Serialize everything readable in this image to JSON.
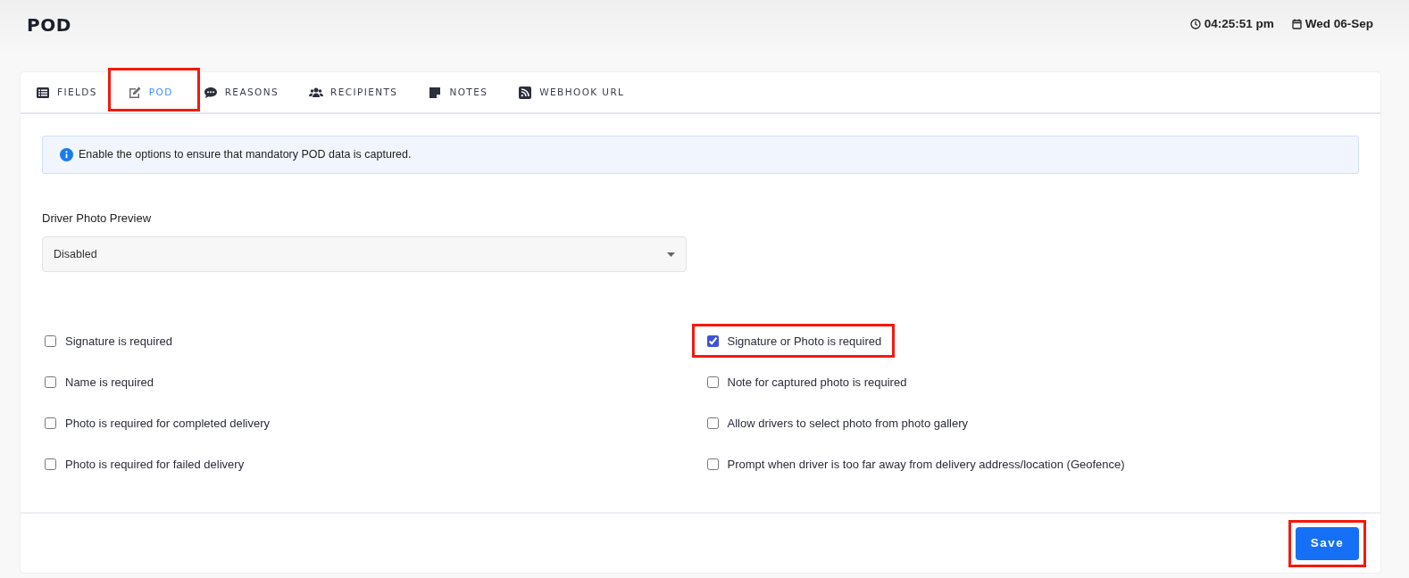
{
  "page": {
    "title": "POD",
    "time": "04:25:51 pm",
    "date": "Wed 06-Sep"
  },
  "tabs": [
    {
      "label": "FIELDS",
      "selected": false,
      "highlighted": false
    },
    {
      "label": "POD",
      "selected": true,
      "highlighted": true
    },
    {
      "label": "REASONS",
      "selected": false,
      "highlighted": false
    },
    {
      "label": "RECIPIENTS",
      "selected": false,
      "highlighted": false
    },
    {
      "label": "NOTES",
      "selected": false,
      "highlighted": false
    },
    {
      "label": "WEBHOOK URL",
      "selected": false,
      "highlighted": false
    }
  ],
  "info": "Enable the options to ensure that mandatory POD data is captured.",
  "driver_photo_preview": {
    "label": "Driver Photo Preview",
    "value": "Disabled"
  },
  "options_left": [
    {
      "label": "Signature is required",
      "checked": false,
      "highlighted": false
    },
    {
      "label": "Name is required",
      "checked": false,
      "highlighted": false
    },
    {
      "label": "Photo is required for completed delivery",
      "checked": false,
      "highlighted": false
    },
    {
      "label": "Photo is required for failed delivery",
      "checked": false,
      "highlighted": false
    }
  ],
  "options_right": [
    {
      "label": "Signature or Photo is required",
      "checked": true,
      "highlighted": true
    },
    {
      "label": "Note for captured photo is required",
      "checked": false,
      "highlighted": false
    },
    {
      "label": "Allow drivers to select photo from photo gallery",
      "checked": false,
      "highlighted": false
    },
    {
      "label": "Prompt when driver is too far away from delivery address/location (Geofence)",
      "checked": false,
      "highlighted": false
    }
  ],
  "save_button": {
    "label": "Save",
    "highlighted": true
  }
}
